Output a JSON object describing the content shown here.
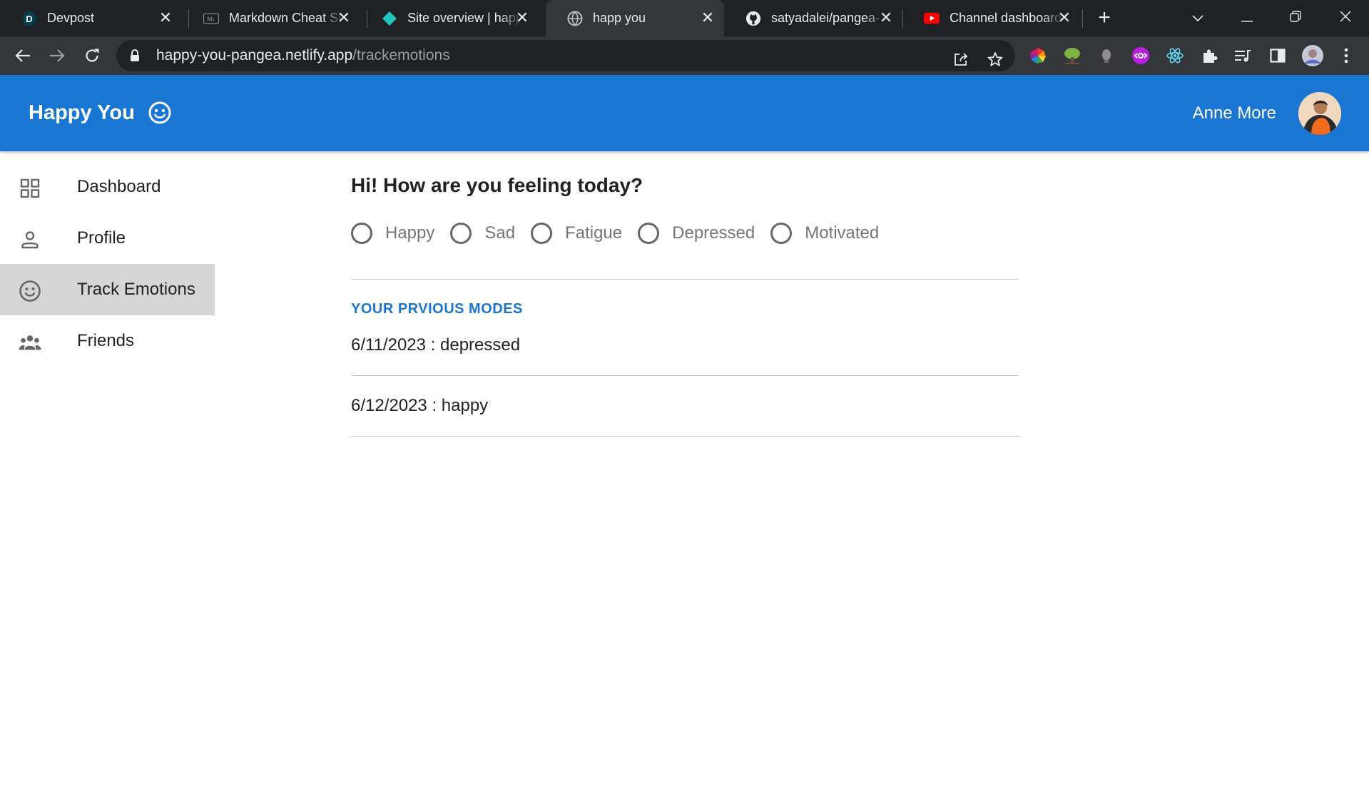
{
  "browser": {
    "tabs": [
      {
        "title": "Devpost",
        "favicon": "devpost-icon",
        "active": false
      },
      {
        "title": "Markdown Cheat Sheet",
        "favicon": "markdown-icon",
        "active": false
      },
      {
        "title": "Site overview | happy",
        "favicon": "netlify-icon",
        "active": false
      },
      {
        "title": "happ you",
        "favicon": "globe-icon",
        "active": true
      },
      {
        "title": "satyadalei/pangea-",
        "favicon": "github-icon",
        "active": false
      },
      {
        "title": "Channel dashboard",
        "favicon": "youtube-icon",
        "active": false
      }
    ],
    "url_host": "happy-you-pangea.netlify.app",
    "url_path": "/trackemotions",
    "extension_icons": [
      "color-wheel-extension-icon",
      "tree-extension-icon",
      "bulb-extension-icon",
      "purple-extension-icon",
      "react-devtools-icon",
      "puzzle-extensions-icon",
      "media-queue-icon",
      "side-panel-icon",
      "profile-avatar-icon",
      "more-menu-icon"
    ]
  },
  "app": {
    "brand": "Happy You",
    "brand_icon": "smiley-icon",
    "user_name": "Anne More",
    "accent_color": "#1976d2"
  },
  "sidebar": {
    "items": [
      {
        "label": "Dashboard",
        "icon": "dashboard-grid-icon",
        "selected": false
      },
      {
        "label": "Profile",
        "icon": "person-icon",
        "selected": false
      },
      {
        "label": "Track Emotions",
        "icon": "smiley-icon",
        "selected": true
      },
      {
        "label": "Friends",
        "icon": "group-icon",
        "selected": false
      }
    ]
  },
  "main": {
    "question": "Hi! How are you feeling today?",
    "moods": [
      "Happy",
      "Sad",
      "Fatigue",
      "Depressed",
      "Motivated"
    ],
    "previous_heading": "YOUR PRVIOUS MODES",
    "previous_entries": [
      "6/11/2023 : depressed",
      "6/12/2023 : happy"
    ]
  }
}
